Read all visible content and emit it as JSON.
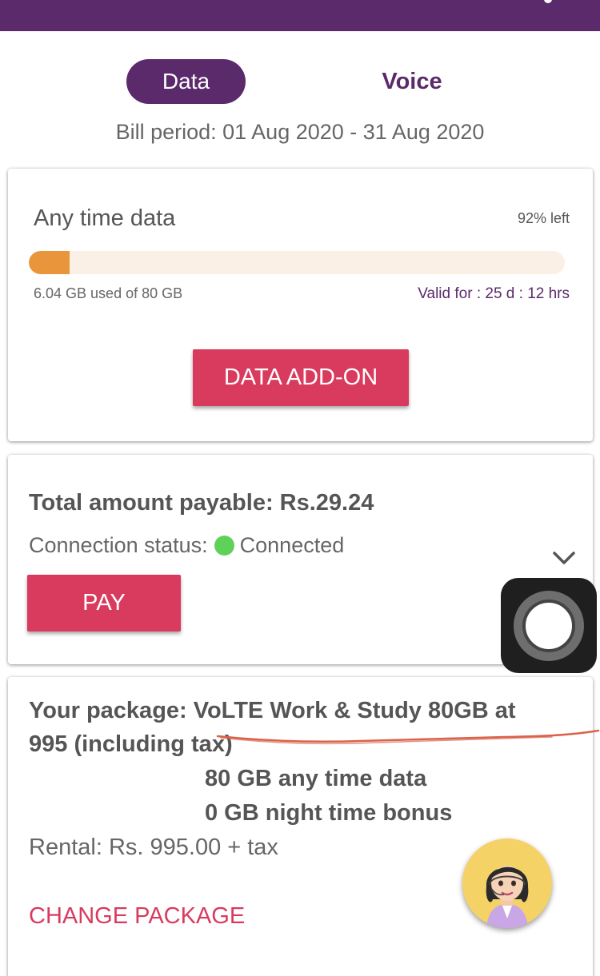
{
  "tabs": [
    {
      "label": "Data",
      "active": true
    },
    {
      "label": "Voice",
      "active": false
    }
  ],
  "bill_period": "Bill period: 01 Aug 2020 - 31 Aug 2020",
  "data_card": {
    "title": "Any time data",
    "percent_left": "92% left",
    "used_fraction": 0.0755,
    "usage": "6.04 GB used of 80 GB",
    "validity": "Valid for : 25 d : 12 hrs",
    "addon_button": "DATA ADD-ON"
  },
  "payment_card": {
    "total": "Total amount payable: Rs.29.24",
    "connection_label": "Connection status:",
    "connection_value": "Connected",
    "pay_button": "PAY"
  },
  "package_card": {
    "line1": "Your package:  VoLTE Work & Study 80GB at",
    "line2": "995 (including tax)",
    "feature1": "80 GB any time data",
    "feature2": "0 GB night time bonus",
    "rental": "Rental: Rs. 995.00 + tax",
    "change_link": "CHANGE PACKAGE"
  },
  "colors": {
    "brand_purple": "#5b2a6b",
    "accent_red": "#d93b5e",
    "progress_orange": "#e8953b",
    "status_green": "#5fd158"
  },
  "icons": {
    "expand": "chevron-down-icon",
    "assistive_touch": "assistive-touch-icon",
    "chat_agent": "agent-avatar-icon"
  }
}
